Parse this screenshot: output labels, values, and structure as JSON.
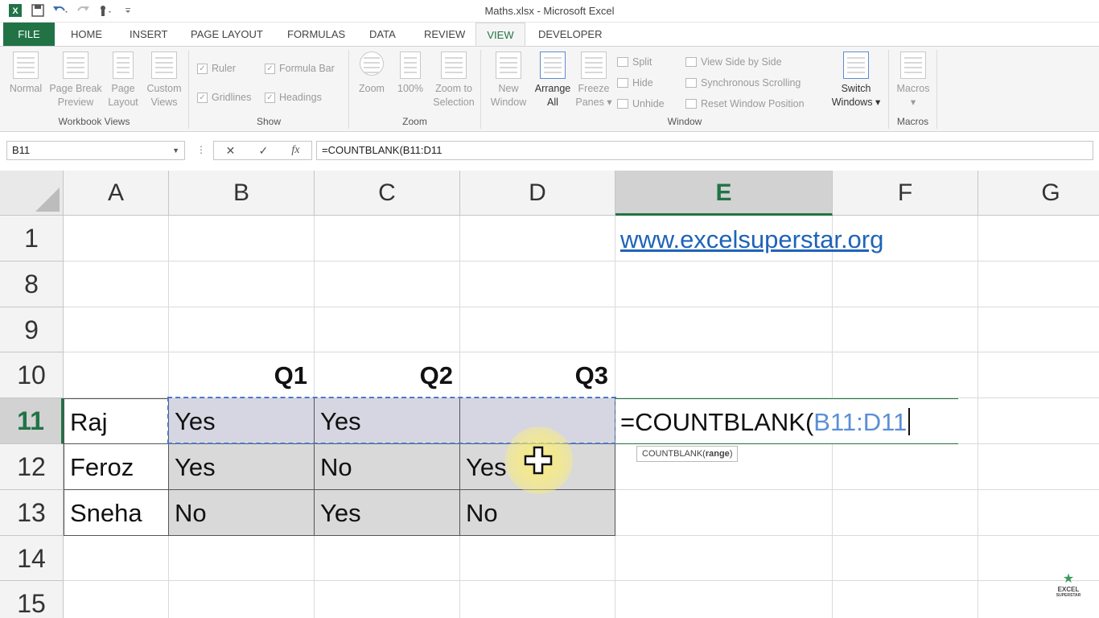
{
  "window": {
    "title": "Maths.xlsx - Microsoft Excel"
  },
  "quick_access": [
    "excel-icon",
    "save-icon",
    "undo-icon",
    "redo-icon",
    "touch-mode-icon",
    "customize-icon"
  ],
  "tabs": [
    {
      "label": "FILE"
    },
    {
      "label": "HOME"
    },
    {
      "label": "INSERT"
    },
    {
      "label": "PAGE LAYOUT"
    },
    {
      "label": "FORMULAS"
    },
    {
      "label": "DATA"
    },
    {
      "label": "REVIEW"
    },
    {
      "label": "VIEW"
    },
    {
      "label": "DEVELOPER"
    }
  ],
  "active_tab": "VIEW",
  "ribbon": {
    "workbook_views": {
      "label": "Workbook Views",
      "normal": "Normal",
      "page_break_1": "Page Break",
      "page_break_2": "Preview",
      "page_layout_1": "Page",
      "page_layout_2": "Layout",
      "custom_views_1": "Custom",
      "custom_views_2": "Views"
    },
    "show": {
      "label": "Show",
      "ruler": "Ruler",
      "formula_bar": "Formula Bar",
      "gridlines": "Gridlines",
      "headings": "Headings"
    },
    "zoom": {
      "label": "Zoom",
      "zoom": "Zoom",
      "hundred": "100%",
      "zoom_sel_1": "Zoom to",
      "zoom_sel_2": "Selection"
    },
    "window": {
      "label": "Window",
      "new_1": "New",
      "new_2": "Window",
      "arrange_1": "Arrange",
      "arrange_2": "All",
      "freeze_1": "Freeze",
      "freeze_2": "Panes",
      "split": "Split",
      "hide": "Hide",
      "unhide": "Unhide",
      "side_by_side": "View Side by Side",
      "sync_scroll": "Synchronous Scrolling",
      "reset_pos": "Reset Window Position",
      "switch_1": "Switch",
      "switch_2": "Windows"
    },
    "macros": {
      "label": "Macros",
      "macros": "Macros"
    }
  },
  "formula_bar": {
    "name_box": "B11",
    "formula": "=COUNTBLANK(B11:D11"
  },
  "grid": {
    "columns": [
      "A",
      "B",
      "C",
      "D",
      "E",
      "F",
      "G"
    ],
    "rows": [
      "1",
      "8",
      "9",
      "10",
      "11",
      "12",
      "13",
      "14",
      "15"
    ],
    "link": "www.excelsuperstar.org",
    "headers": {
      "b": "Q1",
      "c": "Q2",
      "d": "Q3"
    },
    "data": [
      {
        "name": "Raj",
        "q1": "Yes",
        "q2": "Yes",
        "q3": ""
      },
      {
        "name": "Feroz",
        "q1": "Yes",
        "q2": "No",
        "q3": "Yes"
      },
      {
        "name": "Sneha",
        "q1": "No",
        "q2": "Yes",
        "q3": "No"
      }
    ],
    "editing": {
      "prefix": "=COUNTBLANK(",
      "ref": "B11:D11"
    },
    "tooltip": {
      "fn": "COUNTBLANK(",
      "arg": "range",
      "close": ")"
    }
  },
  "logo": {
    "text_1": "EXCEL",
    "text_2": "SUPERSTAR"
  }
}
